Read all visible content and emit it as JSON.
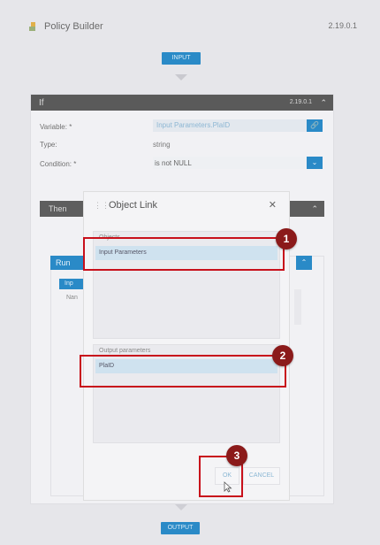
{
  "app": {
    "title": "Policy Builder",
    "version": "2.19.0.1",
    "icon": "policy-builder-icon"
  },
  "flow": {
    "input_label": "INPUT",
    "output_label": "OUTPUT"
  },
  "if_block": {
    "title": "If",
    "version": "2.19.0.1",
    "variable_label": "Variable: *",
    "variable_value": "Input Parameters.PlaID",
    "type_label": "Type:",
    "type_value": "string",
    "condition_label": "Condition: *",
    "condition_value": "is not NULL"
  },
  "then_block": {
    "title": "Then",
    "run_label": "Run",
    "tab_partial": "Inp",
    "name_partial": "Nan"
  },
  "dialog": {
    "title": "Object Link",
    "objects_title": "Objects",
    "objects_selected": "Input Parameters",
    "output_title": "Output parameters",
    "output_selected": "PlaID",
    "ok_label": "OK",
    "cancel_label": "CANCEL"
  },
  "callouts": [
    "1",
    "2",
    "3"
  ],
  "colors": {
    "accent": "#2a8ac7",
    "callout_red": "#c8101b",
    "badge": "#8b1a1a",
    "header_dark": "#5a5a5a"
  }
}
